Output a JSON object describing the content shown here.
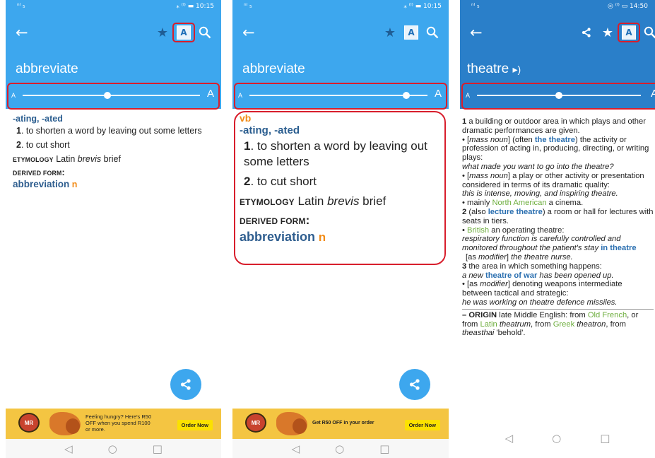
{
  "status": {
    "signal": "ⁿˡ ₅",
    "right1": "⁎ ⁽ᴵ⁾ ▬ 10:15",
    "right2": "⁎ ⁽ᴵ⁾ ▬ 10:15",
    "signal3": "ⁿˡ ₅",
    "right3": "◎ ⁽ᴵ⁾ ▭ 14:50"
  },
  "icons": {
    "back": "←",
    "star": "★",
    "font": "A",
    "search": "⚲",
    "share": "<",
    "speaker": "🔈",
    "nav_back": "◁",
    "nav_home": "○",
    "nav_recent": "□"
  },
  "panel1": {
    "word": "abbreviate",
    "slider_small": "A",
    "slider_big": "A",
    "slider_level": 0.48,
    "forms": "-ating, -ated",
    "senses": [
      {
        "num": "1",
        "text": ". to shorten a word by leaving out some letters"
      },
      {
        "num": "2",
        "text": ". to cut short"
      }
    ],
    "etym_label": "Etymology",
    "etym_text": " Latin ",
    "etym_word": "brevis",
    "etym_tail": " brief",
    "derived_label": "Derived form",
    "derived_colon": ":",
    "derived_word": "abbreviation",
    "derived_pos": "n",
    "ad_text": "Feeling hungry? Here's R50 OFF when you spend R100 or more.",
    "ad_button": "Order Now"
  },
  "panel2": {
    "word": "abbreviate",
    "slider_small": "A",
    "slider_big": "A",
    "slider_level": 0.88,
    "pos_top": "vb",
    "forms": "-ating, -ated",
    "senses": [
      {
        "num": "1",
        "text": ". to shorten a word by leaving out some letters"
      },
      {
        "num": "2",
        "text": ". to cut short"
      }
    ],
    "etym_label": "Etymology",
    "etym_text": " Latin ",
    "etym_word": "brevis",
    "etym_tail": " brief",
    "derived_label": "Derived form",
    "derived_colon": ":",
    "derived_word": "abbreviation",
    "derived_pos": "n",
    "ad_text": "Get R50 OFF in your order",
    "ad_button": "Order Now"
  },
  "panel3": {
    "word": "theatre",
    "slider_small": "A",
    "slider_big": "A",
    "slider_level": 0.5,
    "lines": {
      "s1_num": "1",
      "s1": " a building or outdoor area in which plays and other dramatic performances are given.",
      "b1a": "• [",
      "b1_mass": "mass noun",
      "b1b": "] (often ",
      "b1_xref": "the theatre",
      "b1c": ") the activity or profession of acting in, producing, directing, or writing plays:",
      "ex1": "what made you want to go into the theatre?",
      "b2a": "• [",
      "b2_mass": "mass noun",
      "b2b": "] a play or other activity or presentation considered in terms of its dramatic quality:",
      "ex2": "this is intense, moving, and inspiring theatre.",
      "b3a": "• mainly ",
      "b3_green": "North American",
      "b3b": " a cinema.",
      "s2_num": "2",
      "s2a": " (also ",
      "s2_xref": "lecture theatre",
      "s2b": ") a room or hall for lectures with seats in tiers.",
      "b4a": "• ",
      "b4_green": "British",
      "b4b": " an operating theatre:",
      "ex3": "respiratory function is carefully controlled and monitored throughout the patient's stay ",
      "ex3_xref": "in theatre",
      "b5a": "[as ",
      "b5_mod": "modifier",
      "b5b": "] ",
      "ex4": "the theatre nurse.",
      "s3_num": "3",
      "s3": " the area in which something happens:",
      "ex5a": "a new ",
      "ex5_xref": "theatre of war",
      "ex5b": " has been opened up.",
      "b6a": "• [as ",
      "b6_mod": "modifier",
      "b6b": "] denoting weapons intermediate between tactical and strategic:",
      "ex6": "he was working on theatre defence missiles.",
      "origin_label": "– ORIGIN",
      "o1": " late Middle English: from ",
      "o_g1": "Old French",
      "o2": ", or from ",
      "o_g2": "Latin",
      "o3": " ",
      "o_i1": "theatrum",
      "o4": ", from ",
      "o_g3": "Greek",
      "o5": " ",
      "o_i2": "theatron",
      "o6": ", from ",
      "o_i3": "theasthai",
      "o7": " 'behold'."
    }
  }
}
